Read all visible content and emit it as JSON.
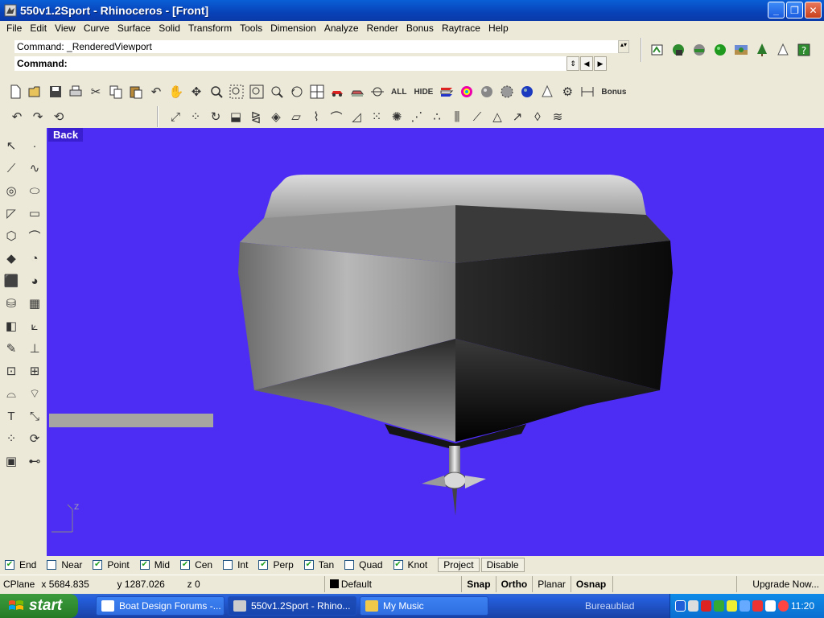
{
  "window": {
    "title": "550v1.2Sport - Rhinoceros - [Front]",
    "minimize": "_",
    "restore": "❐",
    "close": "✕"
  },
  "menu": [
    "File",
    "Edit",
    "View",
    "Curve",
    "Surface",
    "Solid",
    "Transform",
    "Tools",
    "Dimension",
    "Analyze",
    "Render",
    "Bonus",
    "Raytrace",
    "Help"
  ],
  "command": {
    "history": "Command: _RenderedViewport",
    "prompt": "Command:"
  },
  "toolbar": {
    "all_label": "ALL",
    "hide_label": "HIDE",
    "bonus_label": "Bonus"
  },
  "viewport": {
    "label": "Back",
    "axis_z": "Z",
    "background_color": "#4d2cf4"
  },
  "osnap": {
    "items": [
      {
        "label": "End",
        "checked": true
      },
      {
        "label": "Near",
        "checked": false
      },
      {
        "label": "Point",
        "checked": true
      },
      {
        "label": "Mid",
        "checked": true
      },
      {
        "label": "Cen",
        "checked": true
      },
      {
        "label": "Int",
        "checked": false
      },
      {
        "label": "Perp",
        "checked": true
      },
      {
        "label": "Tan",
        "checked": true
      },
      {
        "label": "Quad",
        "checked": false
      },
      {
        "label": "Knot",
        "checked": true
      }
    ],
    "project": "Project",
    "disable": "Disable"
  },
  "status": {
    "cplane": "CPlane",
    "x": "x 5684.835",
    "y": "y 1287.026",
    "z": "z 0",
    "layer": "Default",
    "snap": "Snap",
    "ortho": "Ortho",
    "planar": "Planar",
    "osnap": "Osnap",
    "upgrade": "Upgrade Now..."
  },
  "taskbar": {
    "start": "start",
    "tasks": [
      "Boat Design Forums -...",
      "550v1.2Sport - Rhino...",
      "My Music"
    ],
    "desktop": "Bureaublad",
    "time": "11:20"
  }
}
